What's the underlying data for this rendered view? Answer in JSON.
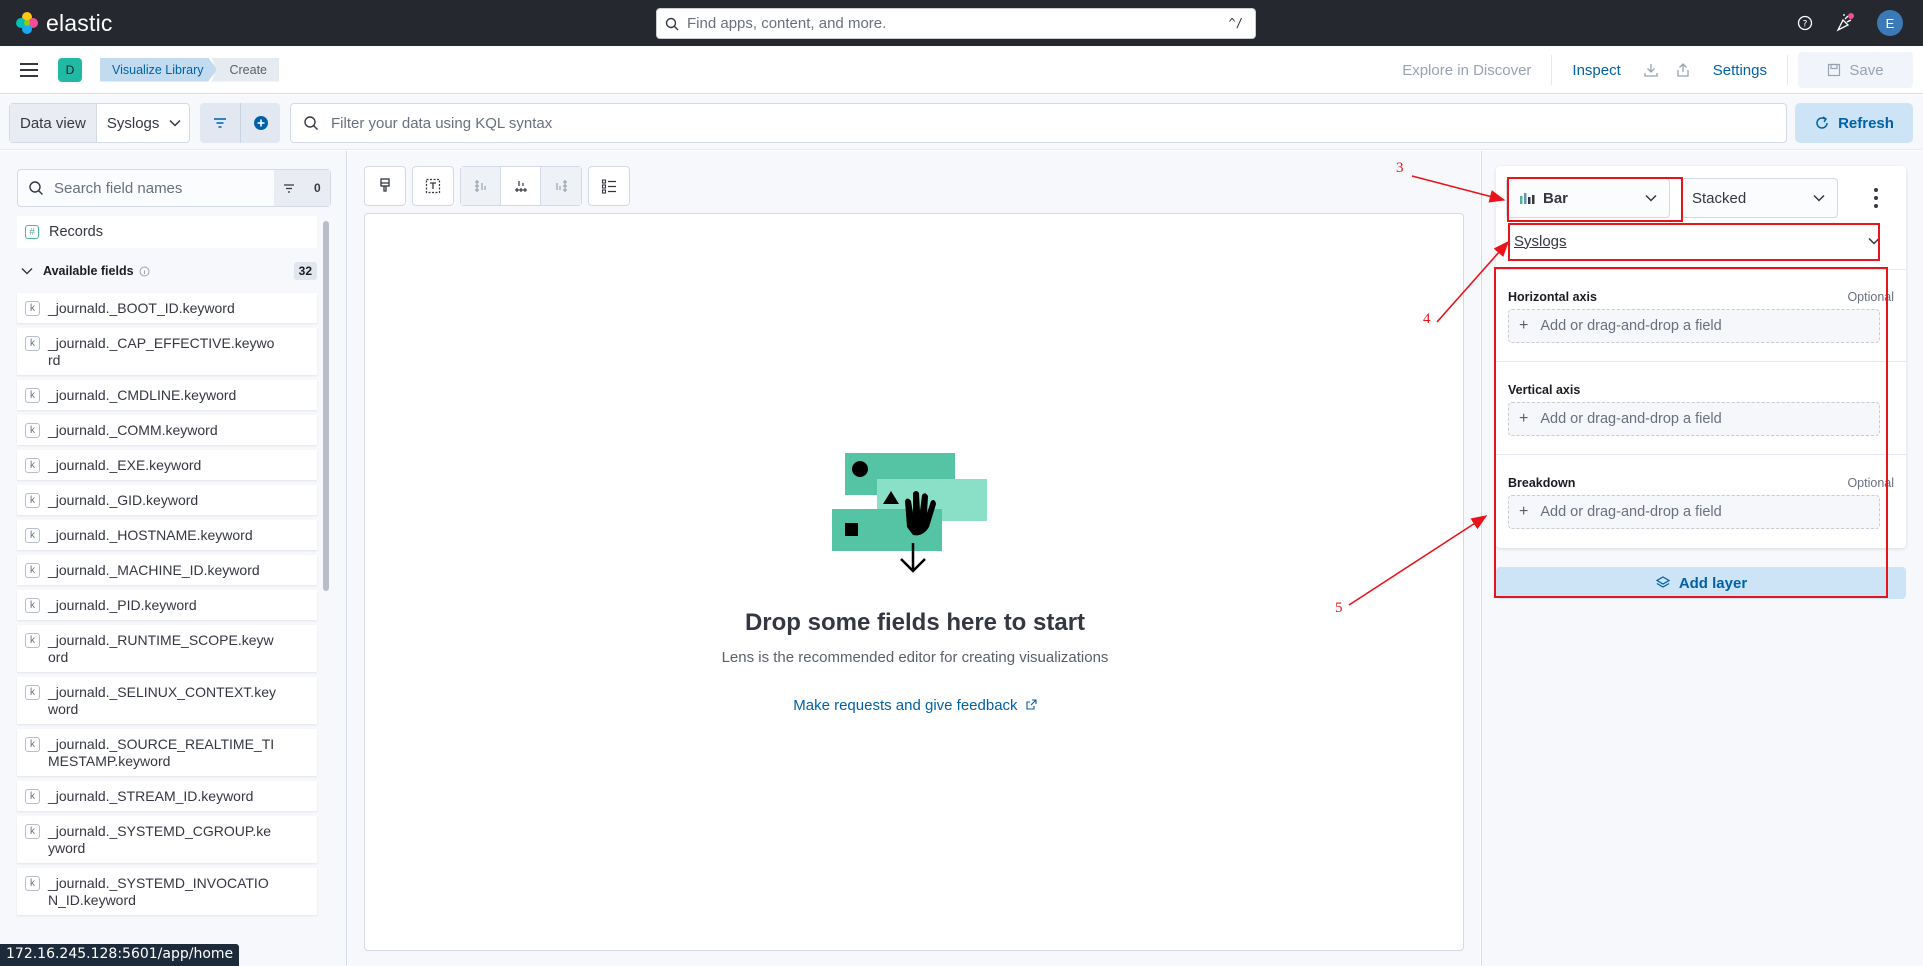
{
  "header": {
    "brand": "elastic",
    "search_placeholder": "Find apps, content, and more.",
    "search_shortcut": "^/",
    "user_initial": "E",
    "space_initial": "D"
  },
  "breadcrumbs": [
    "Visualize Library",
    "Create"
  ],
  "actions": {
    "explore": "Explore in Discover",
    "inspect": "Inspect",
    "settings": "Settings",
    "save": "Save"
  },
  "querybar": {
    "data_view_label": "Data view",
    "data_view_value": "Syslogs",
    "kql_placeholder": "Filter your data using KQL syntax",
    "refresh": "Refresh"
  },
  "field_panel": {
    "search_placeholder": "Search field names",
    "filter_count": "0",
    "records": "Records",
    "available_label": "Available fields",
    "available_count": "32",
    "fields": [
      "_journald._BOOT_ID.keyword",
      "_journald._CAP_EFFECTIVE.keyword",
      "_journald._CMDLINE.keyword",
      "_journald._COMM.keyword",
      "_journald._EXE.keyword",
      "_journald._GID.keyword",
      "_journald._HOSTNAME.keyword",
      "_journald._MACHINE_ID.keyword",
      "_journald._PID.keyword",
      "_journald._RUNTIME_SCOPE.keyword",
      "_journald._SELINUX_CONTEXT.keyword",
      "_journald._SOURCE_REALTIME_TIMESTAMP.keyword",
      "_journald._STREAM_ID.keyword",
      "_journald._SYSTEMD_CGROUP.keyword",
      "_journald._SYSTEMD_INVOCATION_ID.keyword"
    ]
  },
  "workspace": {
    "drop_title": "Drop some fields here to start",
    "drop_subtitle": "Lens is the recommended editor for creating visualizations",
    "feedback_link": "Make requests and give feedback"
  },
  "config": {
    "chart_type": "Bar",
    "stack_mode": "Stacked",
    "data_source": "Syslogs",
    "horizontal_axis": "Horizontal axis",
    "vertical_axis": "Vertical axis",
    "breakdown": "Breakdown",
    "optional": "Optional",
    "drop_hint": "Add or drag-and-drop a field",
    "add_layer": "Add layer"
  },
  "annotations": [
    "3",
    "4",
    "5"
  ],
  "status_url": "172.16.245.128:5601/app/home",
  "colors": {
    "accent": "#0061a6",
    "annotation": "#e8141c",
    "header_bg": "#25282f",
    "illustration_teal": "#54c4a5"
  }
}
